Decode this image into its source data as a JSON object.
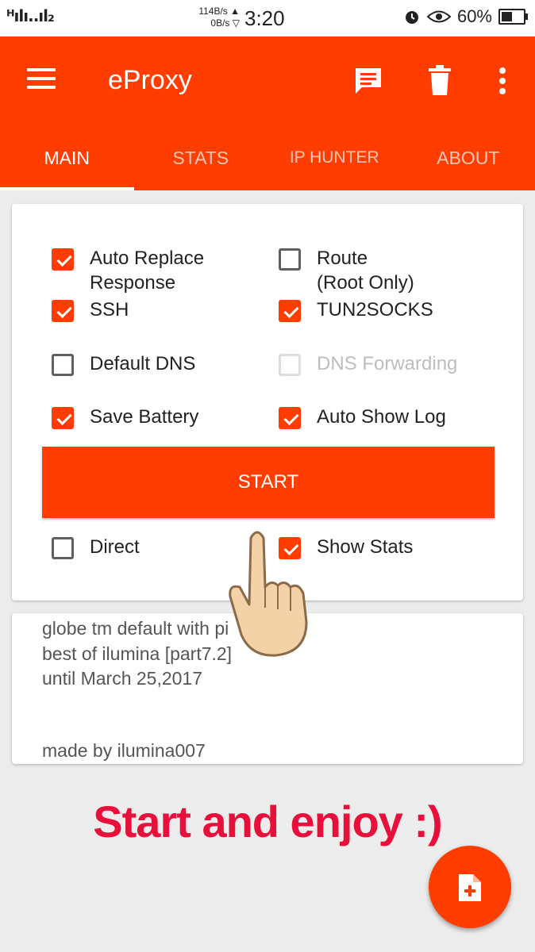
{
  "status_bar": {
    "signal_text": "ᴴılı..ıl₂",
    "net_up": "114B/s ▲",
    "net_down": "0B/s ▽",
    "time": "3:20",
    "battery_percent": "60%",
    "battery_level": 0.6
  },
  "app_bar": {
    "title": "eProxy",
    "icons": [
      "menu-icon",
      "message-icon",
      "delete-icon",
      "more-vert-icon"
    ]
  },
  "tabs": [
    {
      "label": "MAIN",
      "active": true
    },
    {
      "label": "STATS",
      "active": false
    },
    {
      "label": "IP HUNTER",
      "active": false
    },
    {
      "label": "ABOUT",
      "active": false
    }
  ],
  "options": {
    "auto_replace": {
      "label_line1": "Auto Replace",
      "label_line2": "Response",
      "checked": true
    },
    "route": {
      "label_line1": "Route",
      "label_line2": "(Root Only)",
      "checked": false
    },
    "ssh": {
      "label": "SSH",
      "checked": true
    },
    "tun2socks": {
      "label": "TUN2SOCKS",
      "checked": true
    },
    "default_dns": {
      "label": "Default DNS",
      "checked": false
    },
    "dns_forwarding": {
      "label": "DNS Forwarding",
      "checked": false,
      "disabled": true
    },
    "save_battery": {
      "label": "Save Battery",
      "checked": true
    },
    "auto_show_log": {
      "label": "Auto Show Log",
      "checked": true
    },
    "direct": {
      "label": "Direct",
      "checked": false
    },
    "show_stats": {
      "label": "Show Stats",
      "checked": true
    }
  },
  "start_button": {
    "label": "START"
  },
  "log": {
    "line1": "globe tm default with pi",
    "line2": "best of ilumina [part7.2]",
    "line3": "until March 25,2017",
    "line4": "made by ilumina007"
  },
  "caption": "Start and enjoy :)",
  "fab": {
    "icon": "add-file-icon"
  },
  "colors": {
    "accent": "#ff3d00",
    "caption": "#e8103a",
    "background": "#ececec"
  }
}
